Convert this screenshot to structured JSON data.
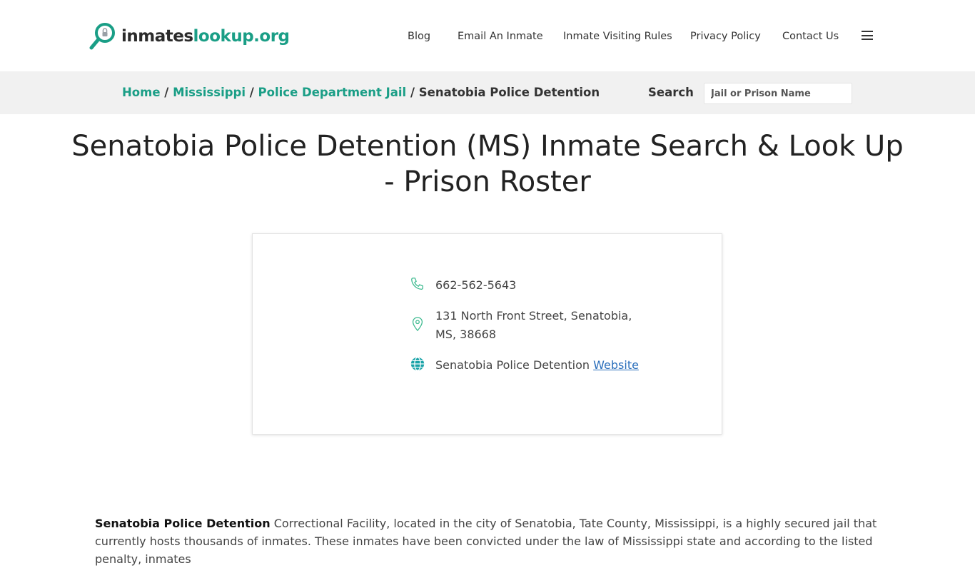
{
  "logo": {
    "part1": "inmates",
    "part2": "lookup.org",
    "colors": {
      "primary": "#1a9e86",
      "dark": "#2b2b2b"
    }
  },
  "nav": {
    "items": [
      {
        "label": "Blog"
      },
      {
        "label": "Email An Inmate"
      },
      {
        "label": "Inmate Visiting Rules"
      },
      {
        "label": "Privacy Policy"
      },
      {
        "label": "Contact Us"
      }
    ],
    "menu_icon": "hamburger-icon"
  },
  "breadcrumb": {
    "items": [
      {
        "label": "Home"
      },
      {
        "label": "Mississippi"
      },
      {
        "label": "Police Department Jail"
      }
    ],
    "separator": "/",
    "current": "Senatobia Police Detention"
  },
  "search": {
    "label": "Search",
    "placeholder": "Jail or Prison Name"
  },
  "page": {
    "title": "Senatobia Police Detention (MS) Inmate Search & Look Up - Prison Roster"
  },
  "card": {
    "phone": "662-562-5643",
    "address": "131 North Front Street, Senatobia, MS, 38668",
    "website_prefix": "Senatobia Police Detention",
    "website_link": "Website",
    "icons": [
      "phone-icon",
      "map-pin-icon",
      "globe-icon"
    ]
  },
  "intro": {
    "bold": "Senatobia Police Detention",
    "text": " Correctional Facility, located in the city of Senatobia, Tate County, Mississippi, is a highly secured jail that currently hosts thousands of inmates. These inmates have been convicted under the law of Mississippi state and according to the listed penalty, inmates"
  }
}
